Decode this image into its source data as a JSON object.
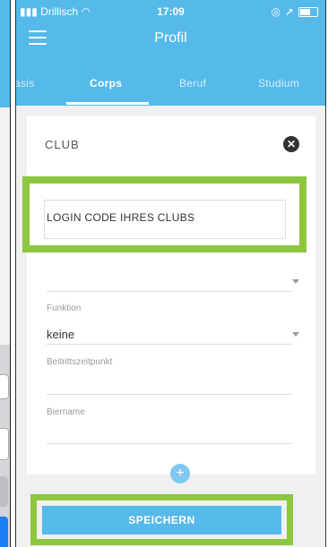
{
  "status": {
    "carrier": "Drillisch",
    "time": "17:09"
  },
  "header": {
    "title": "Profil",
    "tabs": [
      {
        "label": "asis"
      },
      {
        "label": "Corps"
      },
      {
        "label": "Beruf"
      },
      {
        "label": "Studium"
      }
    ]
  },
  "form": {
    "section_label": "CLUB",
    "login_placeholder": "LOGIN CODE IHRES CLUBS",
    "funktion_label": "Funktion",
    "funktion_value": "keine",
    "beitritt_label": "Beitrittszeitpunkt",
    "biername_label": "Biername"
  },
  "actions": {
    "save_label": "SPEICHERN",
    "add_label": "+"
  },
  "colors": {
    "header": "#55b9ea",
    "highlight": "#8dc63f"
  }
}
